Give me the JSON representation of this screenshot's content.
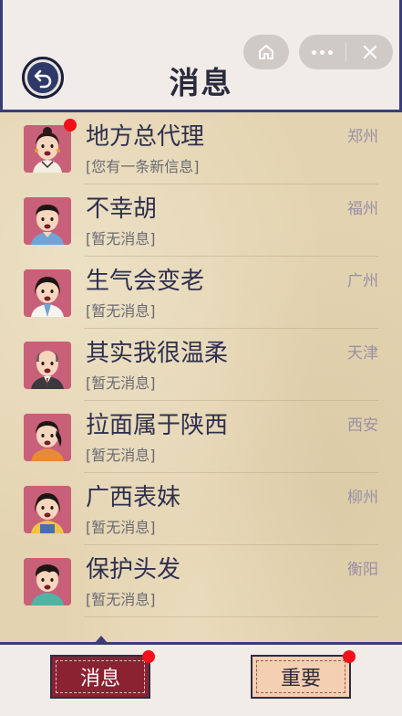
{
  "header": {
    "title": "消息",
    "back_icon": "back-arrow-icon",
    "capsule": {
      "home_icon": "home-icon",
      "more_icon": "more-dots-icon",
      "close_icon": "close-icon"
    }
  },
  "contacts": [
    {
      "name": "地方总代理",
      "message": "[您有一条新信息]",
      "city": "郑州",
      "unread": true,
      "avatar": "woman-bun-avatar"
    },
    {
      "name": "不幸胡",
      "message": "[暂无消息]",
      "city": "福州",
      "unread": false,
      "avatar": "man-glasses-avatar"
    },
    {
      "name": "生气会变老",
      "message": "[暂无消息]",
      "city": "广州",
      "unread": false,
      "avatar": "woman-doctor-avatar"
    },
    {
      "name": "其实我很温柔",
      "message": "[暂无消息]",
      "city": "天津",
      "unread": false,
      "avatar": "bald-man-suit-avatar"
    },
    {
      "name": "拉面属于陕西",
      "message": "[暂无消息]",
      "city": "西安",
      "unread": false,
      "avatar": "woman-orange-avatar"
    },
    {
      "name": "广西表妹",
      "message": "[暂无消息]",
      "city": "柳州",
      "unread": false,
      "avatar": "girl-overalls-avatar"
    },
    {
      "name": "保护头发",
      "message": "[暂无消息]",
      "city": "衡阳",
      "unread": false,
      "avatar": "man-teal-shirt-avatar"
    }
  ],
  "tabs": [
    {
      "label": "消息",
      "active": true,
      "badge": true
    },
    {
      "label": "重要",
      "active": false,
      "badge": true
    }
  ],
  "colors": {
    "accent_navy": "#3b3d78",
    "active_tab": "#8a2231",
    "inactive_tab": "#f4cfb2",
    "badge_red": "#f2101a",
    "list_bg": "#e3d3b0"
  }
}
